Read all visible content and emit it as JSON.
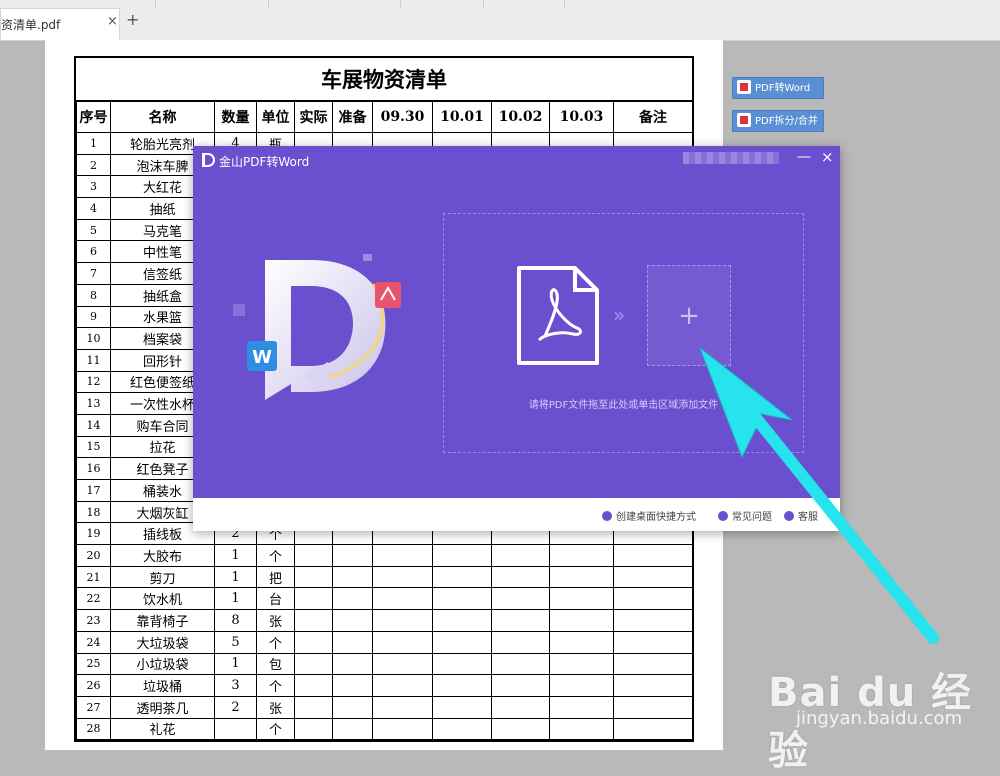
{
  "tabbar": {
    "tab_label": "资清单.pdf",
    "close_glyph": "×",
    "add_glyph": "+"
  },
  "document": {
    "title": "车展物资清单",
    "headers": [
      "序号",
      "名称",
      "数量",
      "单位",
      "实际",
      "准备",
      "09.30",
      "10.01",
      "10.02",
      "10.03",
      "备注"
    ],
    "rows": [
      [
        "1",
        "轮胎光亮剂",
        "4",
        "瓶"
      ],
      [
        "2",
        "泡沫车脾",
        "",
        ""
      ],
      [
        "3",
        "大红花",
        "",
        ""
      ],
      [
        "4",
        "抽纸",
        "",
        ""
      ],
      [
        "5",
        "马克笔",
        "",
        ""
      ],
      [
        "6",
        "中性笔",
        "",
        ""
      ],
      [
        "7",
        "信签纸",
        "",
        ""
      ],
      [
        "8",
        "抽纸盒",
        "",
        ""
      ],
      [
        "9",
        "水果篮",
        "",
        ""
      ],
      [
        "10",
        "档案袋",
        "",
        ""
      ],
      [
        "11",
        "回形针",
        "",
        ""
      ],
      [
        "12",
        "红色便签纸",
        "",
        ""
      ],
      [
        "13",
        "一次性水杯",
        "",
        ""
      ],
      [
        "14",
        "购车合同",
        "",
        ""
      ],
      [
        "15",
        "拉花",
        "",
        ""
      ],
      [
        "16",
        "红色凳子",
        "",
        ""
      ],
      [
        "17",
        "桶装水",
        "",
        ""
      ],
      [
        "18",
        "大烟灰缸",
        "",
        ""
      ],
      [
        "19",
        "插线板",
        "2",
        "个"
      ],
      [
        "20",
        "大胶布",
        "1",
        "个"
      ],
      [
        "21",
        "剪刀",
        "1",
        "把"
      ],
      [
        "22",
        "饮水机",
        "1",
        "台"
      ],
      [
        "23",
        "靠背椅子",
        "8",
        "张"
      ],
      [
        "24",
        "大垃圾袋",
        "5",
        "个"
      ],
      [
        "25",
        "小垃圾袋",
        "1",
        "包"
      ],
      [
        "26",
        "垃圾桶",
        "3",
        "个"
      ],
      [
        "27",
        "透明茶几",
        "2",
        "张"
      ],
      [
        "28",
        "礼花",
        "",
        "个"
      ]
    ]
  },
  "side_buttons": [
    {
      "label": "PDF转Word"
    },
    {
      "label": "PDF拆分/合并"
    }
  ],
  "dialog": {
    "title": "金山PDF转Word",
    "minimize_glyph": "—",
    "close_glyph": "×",
    "add_glyph": "+",
    "chevron_glyph": "»",
    "drop_hint": "请将PDF文件拖至此处或单击区域添加文件",
    "footer": {
      "shortcut": "创建桌面快捷方式",
      "faq": "常见问题",
      "service": "客服"
    }
  },
  "watermark": {
    "logo": "Bai du 经验",
    "url": "jingyan.baidu.com"
  },
  "colors": {
    "dialog_purple": "#6a4fcf",
    "arrow_cyan": "#27e3ee",
    "side_button_blue": "#5b8fd3"
  }
}
